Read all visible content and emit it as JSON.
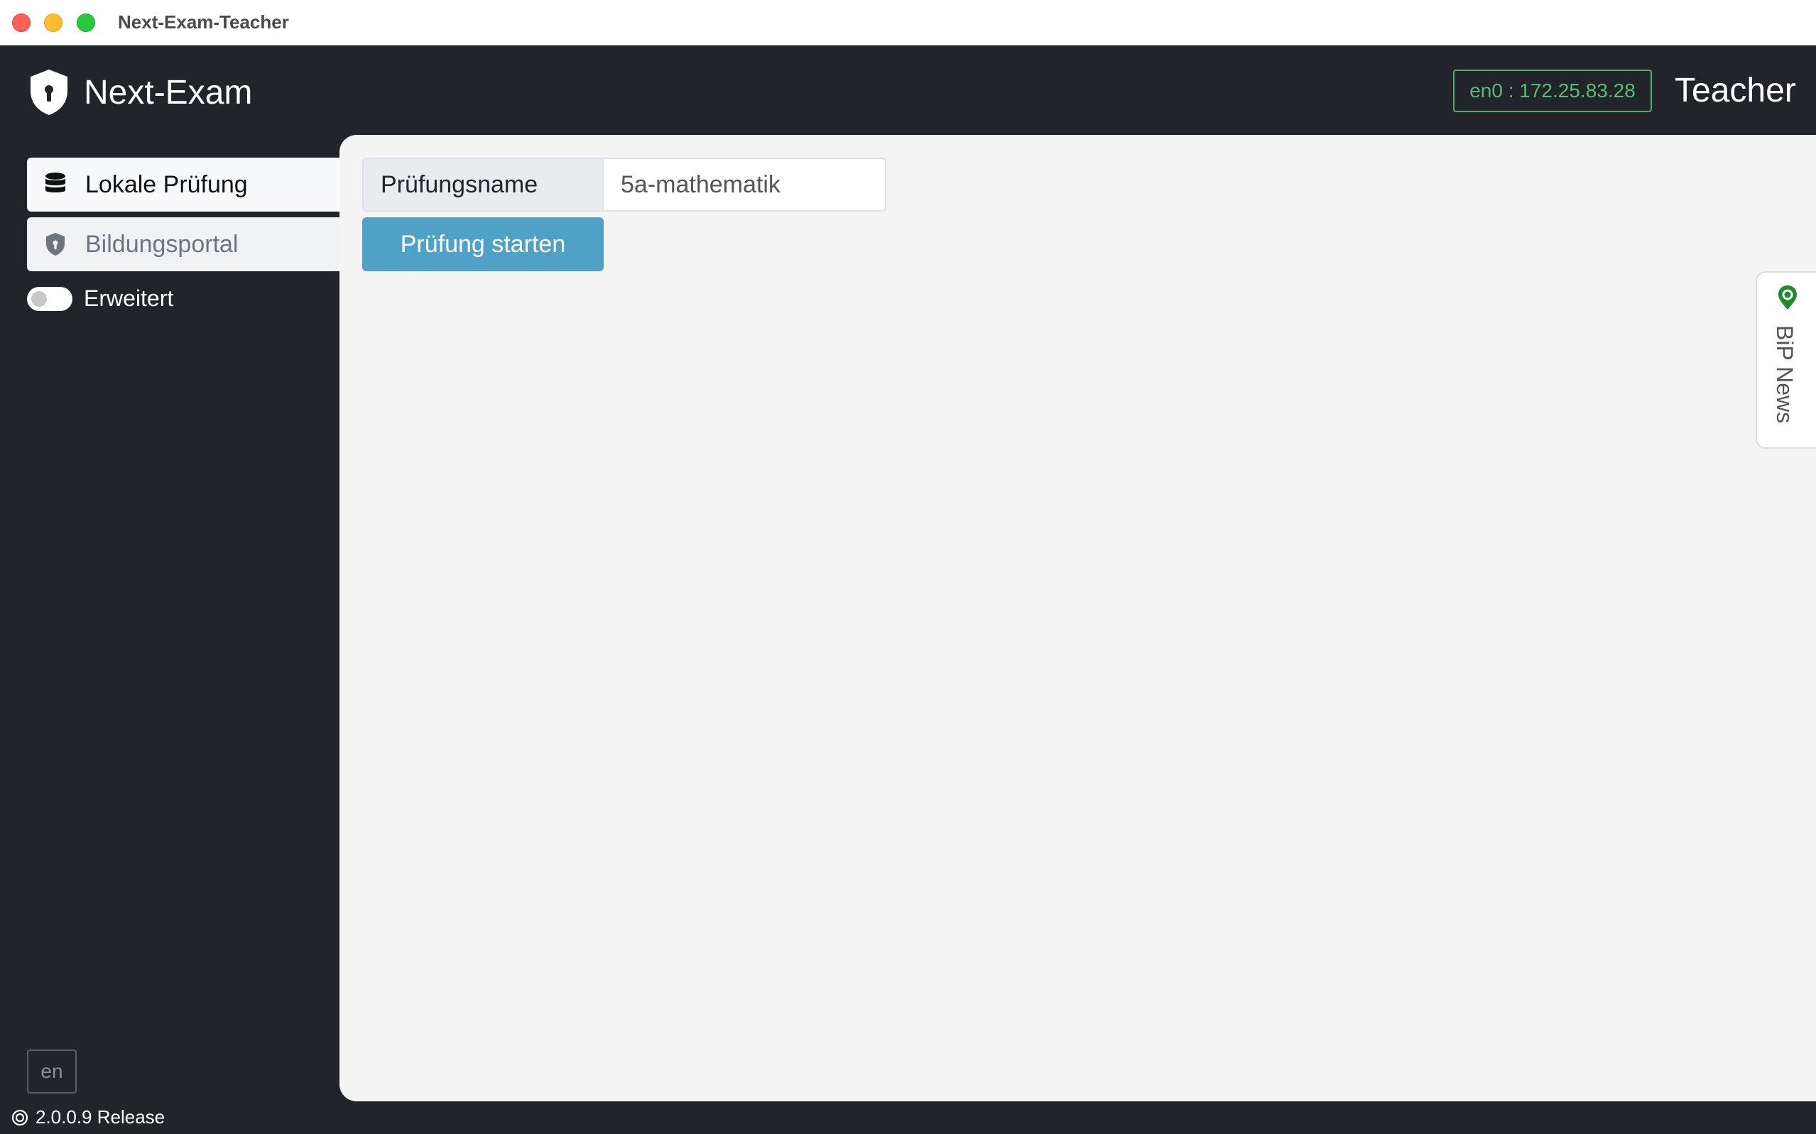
{
  "window": {
    "title": "Next-Exam-Teacher"
  },
  "header": {
    "app_name": "Next-Exam",
    "network_badge": "en0 : 172.25.83.28",
    "role": "Teacher"
  },
  "sidebar": {
    "items": [
      {
        "label": "Lokale Prüfung",
        "icon": "database-icon",
        "active": true
      },
      {
        "label": "Bildungsportal",
        "icon": "shield-icon",
        "active": false
      }
    ],
    "toggle": {
      "label": "Erweitert",
      "checked": false
    },
    "language": "en",
    "version": "2.0.0.9 Release"
  },
  "main": {
    "exam_name_label": "Prüfungsname",
    "exam_name_value": "5a-mathematik",
    "start_button": "Prüfung starten"
  },
  "news_tab": {
    "label": "BiP News"
  },
  "colors": {
    "app_background": "#212529",
    "panel_background": "#f4f4f4",
    "primary_button": "#4fa1c5",
    "badge_green": "#5cb879",
    "news_icon_green": "#1e8a2e"
  }
}
